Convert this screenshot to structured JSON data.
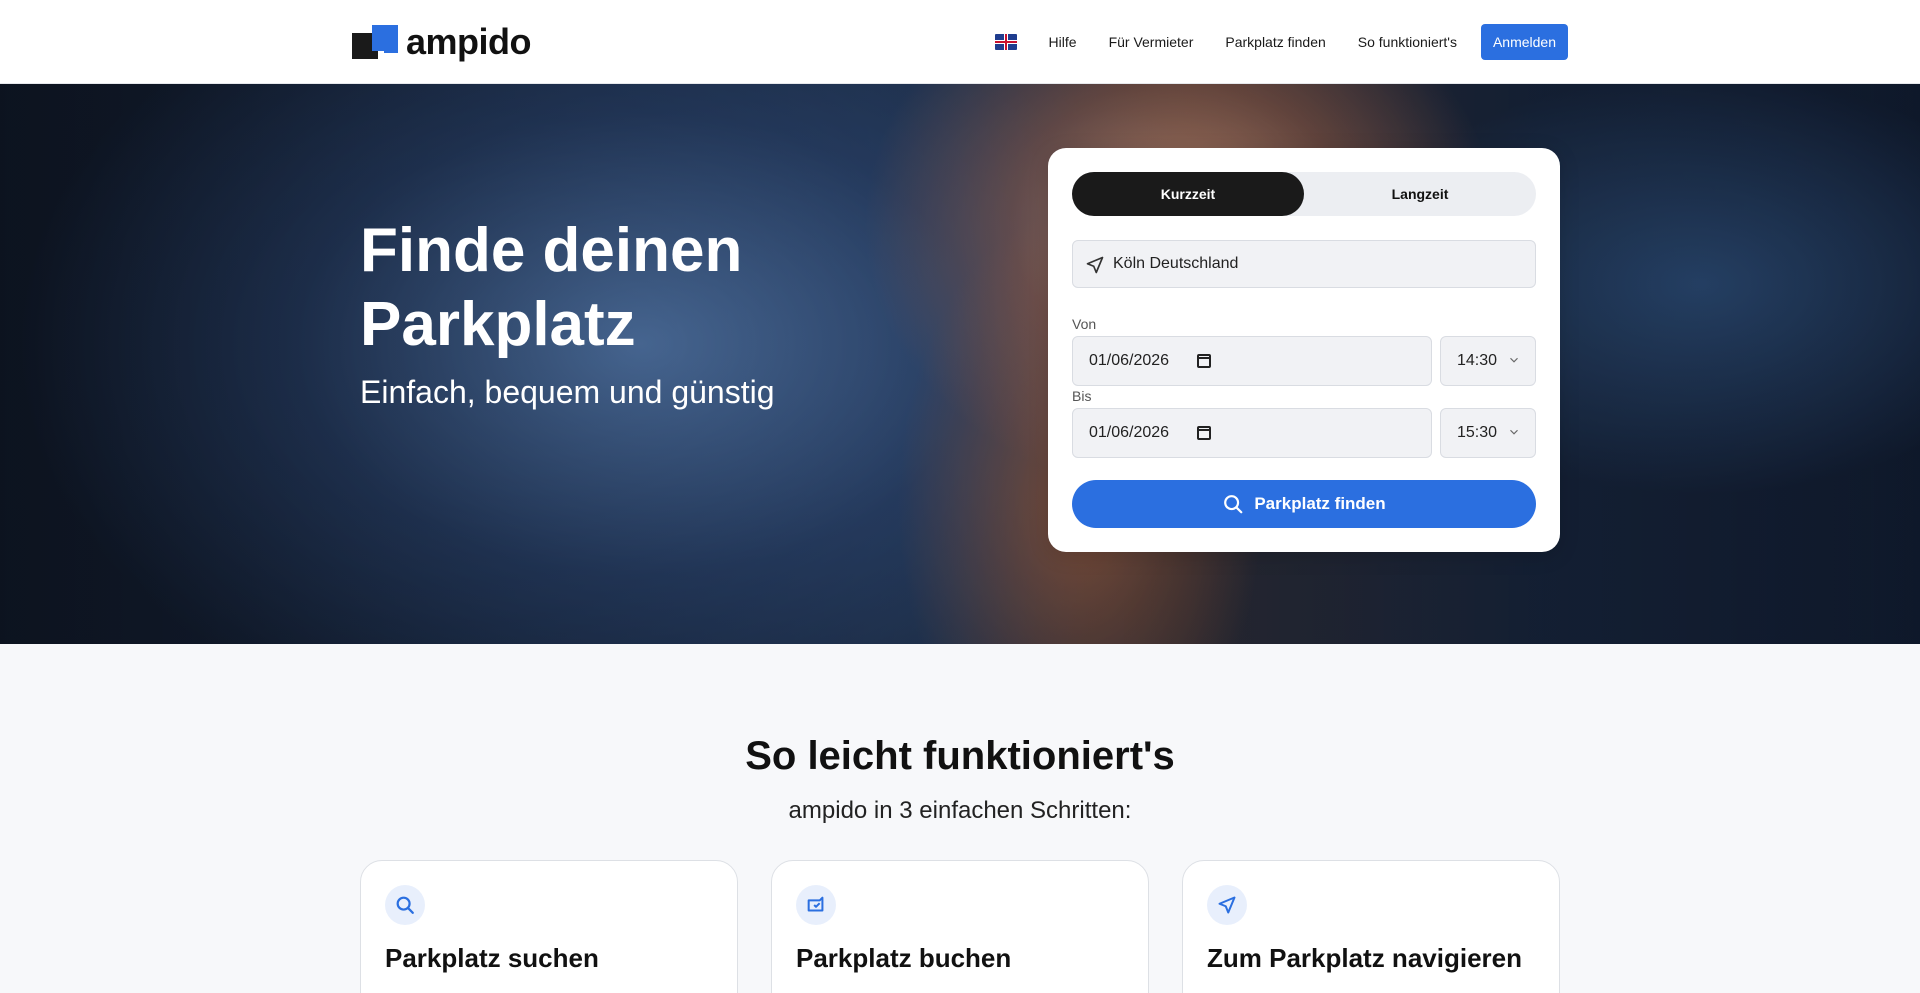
{
  "brand": {
    "name": "ampido",
    "accent": "#2b6fe0"
  },
  "nav": {
    "language_flag": "uk-flag-icon",
    "items": [
      "Hilfe",
      "Für Vermieter",
      "Parkplatz finden",
      "So funktioniert's"
    ],
    "login_label": "Anmelden"
  },
  "hero": {
    "title": "Finde deinen Parkplatz",
    "subtitle": "Einfach, bequem und günstig"
  },
  "search": {
    "tabs": [
      "Kurzzeit",
      "Langzeit"
    ],
    "active_tab": "Kurzzeit",
    "location_value": "Köln Deutschland",
    "from_label": "Von",
    "from_date": "01/06/2026",
    "from_time": "14:30",
    "to_label": "Bis",
    "to_date": "01/06/2026",
    "to_time": "15:30",
    "submit_label": "Parkplatz finden"
  },
  "how": {
    "title": "So leicht funktioniert's",
    "subtitle": "ampido in 3 einfachen Schritten:",
    "steps": [
      {
        "title": "Parkplatz suchen",
        "icon": "search-icon"
      },
      {
        "title": "Parkplatz buchen",
        "icon": "wallet-icon"
      },
      {
        "title": "Zum Parkplatz navigieren",
        "icon": "navigation-icon"
      }
    ]
  }
}
